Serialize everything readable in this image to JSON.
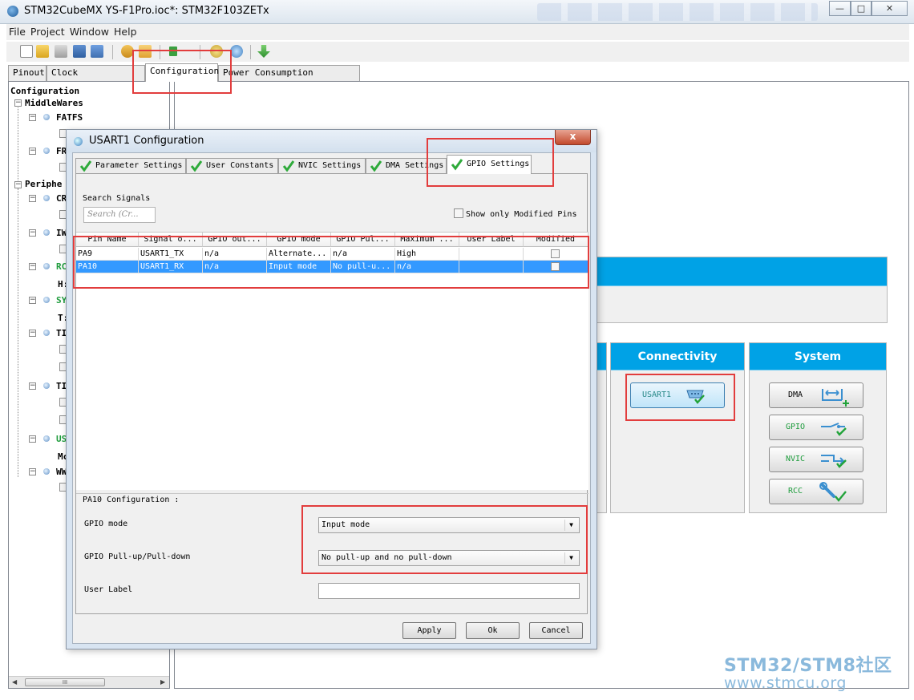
{
  "window": {
    "title": "STM32CubeMX YS-F1Pro.ioc*: STM32F103ZETx",
    "minimize": "—",
    "maximize": "□",
    "close": "✕"
  },
  "menu": [
    "File",
    "Project",
    "Window",
    "Help"
  ],
  "main_tabs": [
    "Pinout",
    "Clock Configuration",
    "Configuration",
    "Power Consumption Calculator"
  ],
  "tree": {
    "root": "Configuration",
    "middlewares": "MiddleWares",
    "fatfs": "FATFS",
    "fr": "FR",
    "peripherals": "Periphe",
    "items": [
      "CR",
      "IW",
      "RC",
      "H:",
      "SY",
      "T:",
      "TI",
      "TI",
      "US",
      "Mc",
      "WW"
    ]
  },
  "scroll_grip": "III",
  "categories": {
    "connectivity": "Connectivity",
    "system": "System"
  },
  "peripheral_buttons": {
    "usart1": "USART1",
    "dma": "DMA",
    "gpio": "GPIO",
    "nvic": "NVIC",
    "rcc": "RCC"
  },
  "dialog": {
    "title": "USART1 Configuration",
    "close": "x",
    "tabs": [
      "Parameter Settings",
      "User Constants",
      "NVIC Settings",
      "DMA Settings",
      "GPIO Settings"
    ],
    "search_label": "Search Signals",
    "search_placeholder": "Search (Cr...",
    "show_modified": "Show only Modified Pins",
    "columns": [
      "Pin Name",
      "Signal o...",
      "GPIO out...",
      "GPIO mode",
      "GPIO Pul...",
      "Maximum ...",
      "User Label",
      "Modified"
    ],
    "rows": [
      {
        "pin": "PA9",
        "signal": "USART1_TX",
        "output": "n/a",
        "mode": "Alternate...",
        "pull": "n/a",
        "speed": "High",
        "label": ""
      },
      {
        "pin": "PA10",
        "signal": "USART1_RX",
        "output": "n/a",
        "mode": "Input mode",
        "pull": "No pull-u...",
        "speed": "n/a",
        "label": ""
      }
    ],
    "config_title": "PA10 Configuration :",
    "fields": {
      "gpio_mode_label": "GPIO mode",
      "gpio_mode_value": "Input mode",
      "pull_label": "GPIO Pull-up/Pull-down",
      "pull_value": "No pull-up and no pull-down",
      "user_label": "User Label",
      "user_label_value": ""
    },
    "buttons": {
      "apply": "Apply",
      "ok": "Ok",
      "cancel": "Cancel"
    }
  },
  "watermark": {
    "line1": "STM32/STM8社区",
    "line2": "www.stmcu.org"
  }
}
